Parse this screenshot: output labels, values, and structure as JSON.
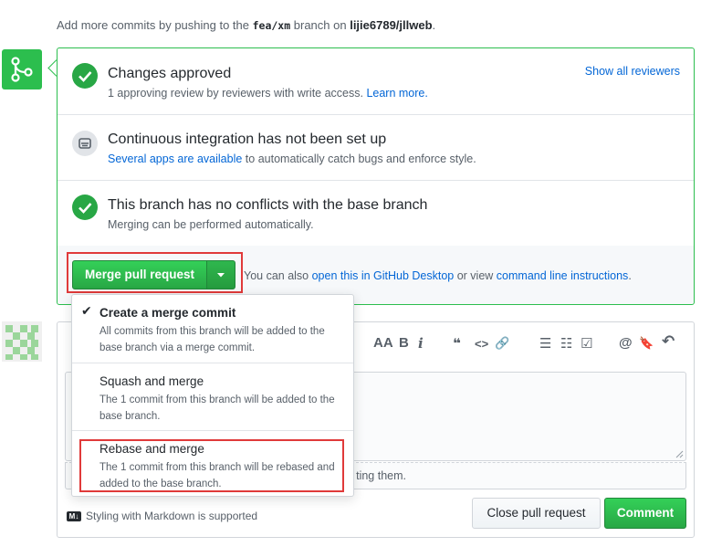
{
  "hint": {
    "prefix": "Add more commits by pushing to the ",
    "branch": "fea/xm",
    "middle": " branch on ",
    "repo": "lijie6789/jllweb",
    "suffix": "."
  },
  "approved": {
    "title": "Changes approved",
    "subtitle": "1 approving review by reviewers with write access.",
    "learn_more": "Learn more.",
    "show_reviewers": "Show all reviewers"
  },
  "ci": {
    "title": "Continuous integration has not been set up",
    "link": "Several apps are available",
    "rest": " to automatically catch bugs and enforce style."
  },
  "conflicts": {
    "title": "This branch has no conflicts with the base branch",
    "subtitle": "Merging can be performed automatically."
  },
  "merge": {
    "button_label": "Merge pull request",
    "note_prefix": "You can also ",
    "desktop_link": "open this in GitHub Desktop",
    "note_middle": " or view ",
    "cli_link": "command line instructions",
    "note_suffix": "."
  },
  "dropdown": {
    "items": [
      {
        "title": "Create a merge commit",
        "desc": "All commits from this branch will be added to the base branch via a merge commit.",
        "selected": true
      },
      {
        "title": "Squash and merge",
        "desc": "The 1 commit from this branch will be added to the base branch.",
        "selected": false
      },
      {
        "title": "Rebase and merge",
        "desc": "The 1 commit from this branch will be rebased and added to the base branch.",
        "selected": false
      }
    ]
  },
  "toolbar": {
    "heading": "AA",
    "bold": "B",
    "italic": "i",
    "quote": "❝",
    "code": "<>",
    "link": "🔗",
    "ul": "☰",
    "ol": "☷",
    "task": "☑",
    "mention": "@",
    "bookmark": "🔖",
    "reply": "↶"
  },
  "comment": {
    "attach_text": "ting them.",
    "markdown_note": "Styling with Markdown is supported",
    "close_button": "Close pull request",
    "comment_button": "Comment"
  },
  "colors": {
    "success": "#28a745",
    "link": "#0366d6",
    "highlight": "#e03a3a"
  }
}
